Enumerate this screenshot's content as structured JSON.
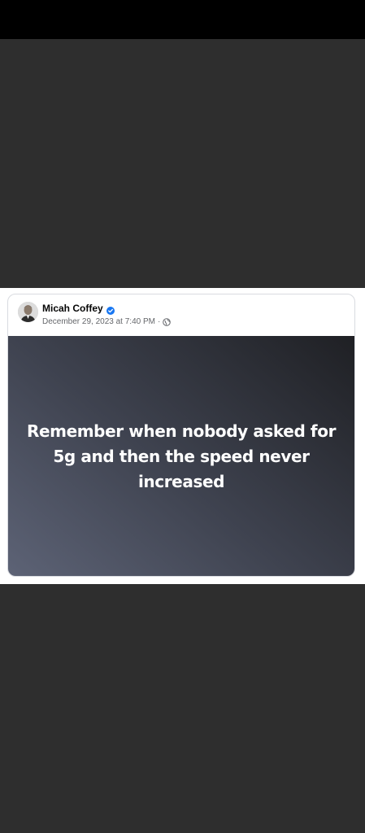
{
  "post": {
    "author": "Micah Coffey",
    "verified_icon": "verified-badge-icon",
    "timestamp": "December 29, 2023 at 7:40 PM",
    "separator": "·",
    "audience_icon": "globe-icon",
    "text": "Remember when nobody asked for 5g and then the speed never increased",
    "colors": {
      "verified": "#1877f2",
      "gradient_start": "#5d6376",
      "gradient_end": "#1f2024"
    }
  }
}
